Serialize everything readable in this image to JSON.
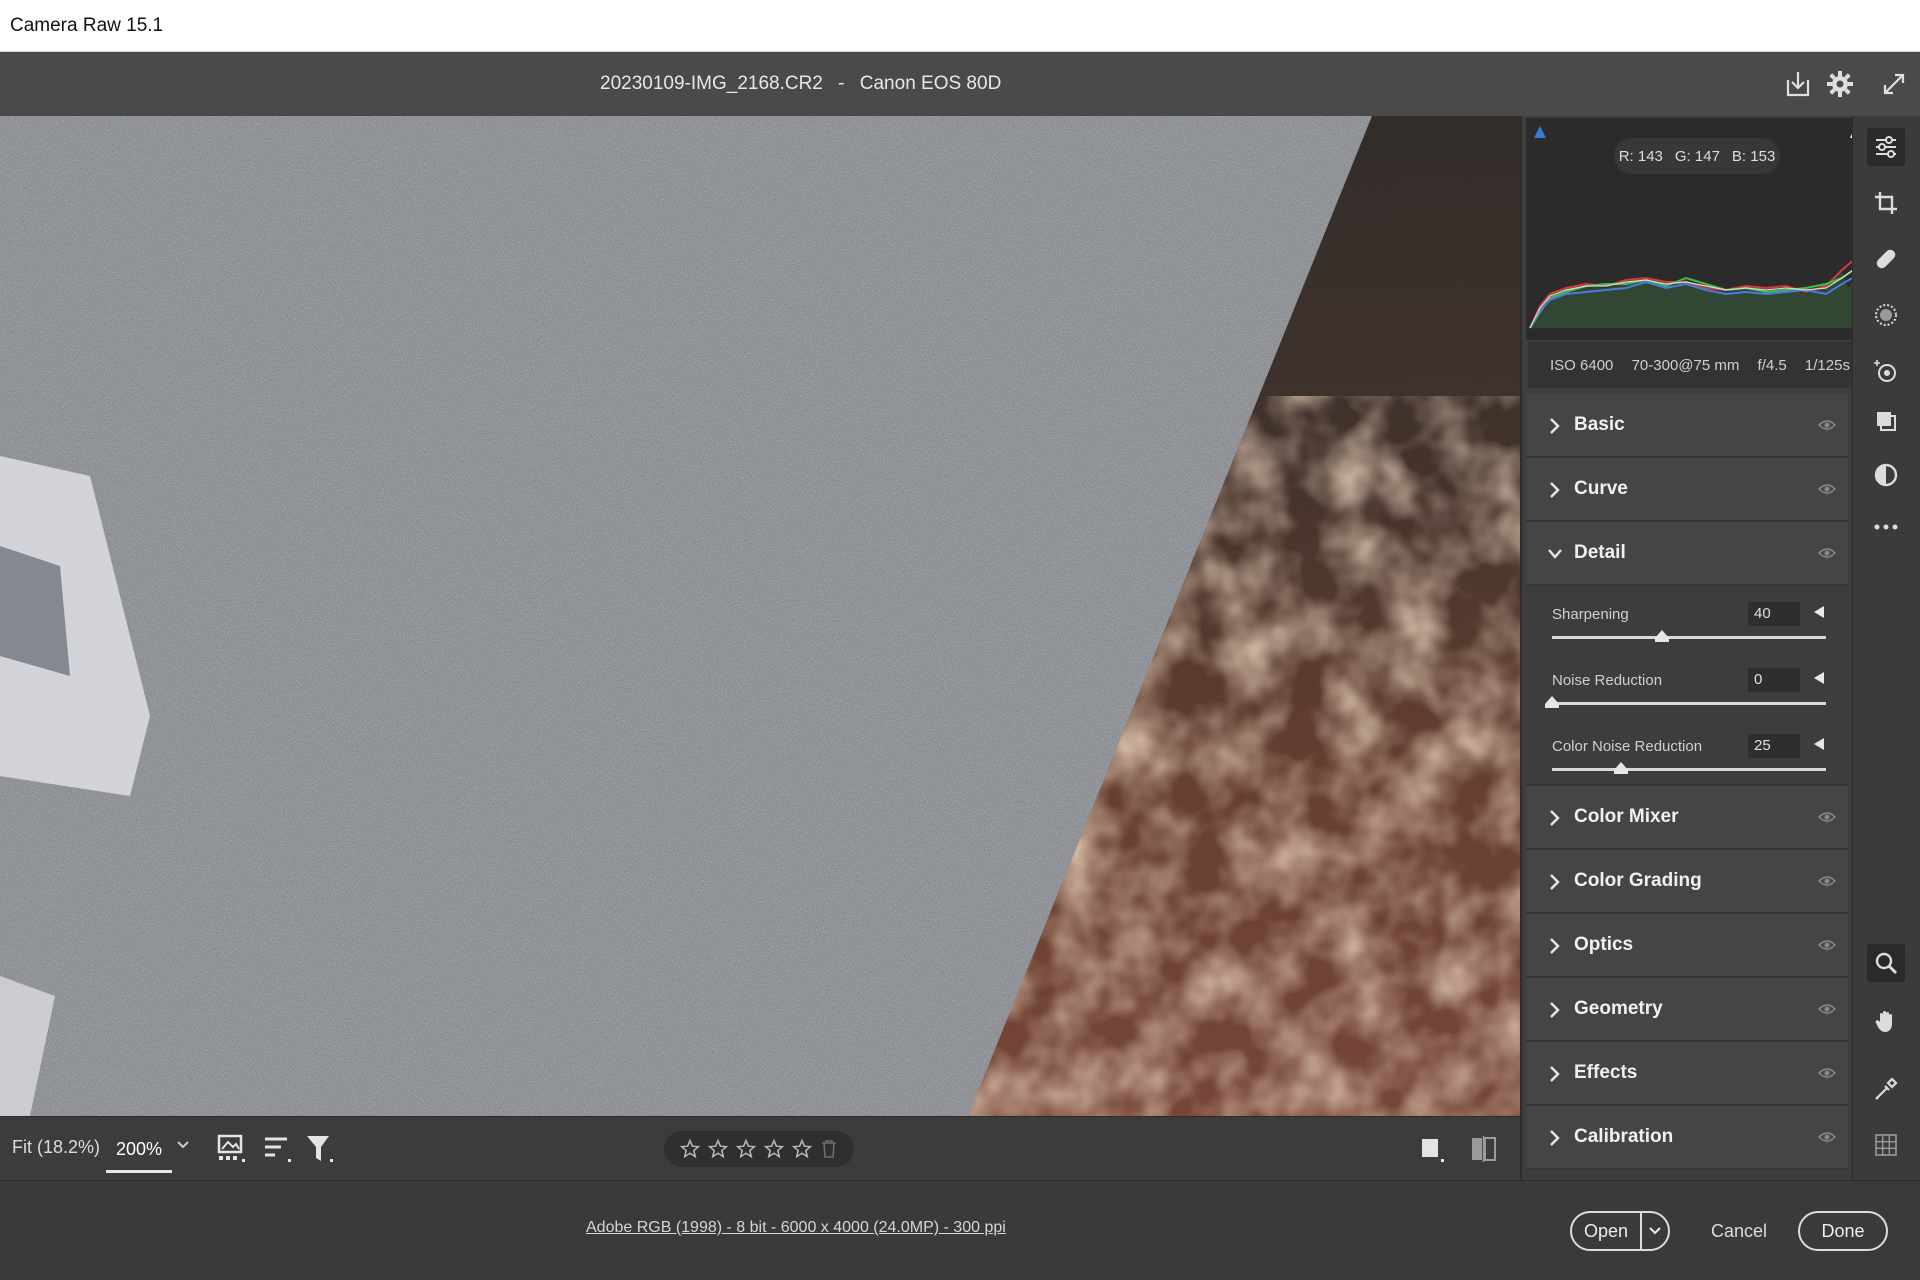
{
  "os_titlebar": {
    "title": "Camera Raw 15.1"
  },
  "header": {
    "filename": "20230109-IMG_2168.CR2",
    "separator": "-",
    "camera": "Canon EOS 80D",
    "icons": [
      "save-icon",
      "settings-gear-icon",
      "fullscreen-icon"
    ]
  },
  "histogram": {
    "readout": {
      "r": "R: 143",
      "g": "G: 147",
      "b": "B: 153"
    },
    "exif": {
      "iso": "ISO 6400",
      "lens": "70-300@75 mm",
      "aperture": "f/4.5",
      "shutter": "1/125s"
    }
  },
  "sections": {
    "basic": "Basic",
    "curve": "Curve",
    "detail": "Detail",
    "color_mixer": "Color Mixer",
    "color_grading": "Color Grading",
    "optics": "Optics",
    "geometry": "Geometry",
    "effects": "Effects",
    "calibration": "Calibration"
  },
  "detail": {
    "sharpening": {
      "label": "Sharpening",
      "value": "40",
      "level": 0.4
    },
    "noise_reduction": {
      "label": "Noise Reduction",
      "value": "0",
      "level": 0.0
    },
    "color_noise_reduction": {
      "label": "Color Noise Reduction",
      "value": "25",
      "level": 0.25
    }
  },
  "bottom_toolbar": {
    "fit_label": "Fit (18.2%)",
    "zoom_value": "200%",
    "rating_stars": 0
  },
  "footer": {
    "image_info": "Adobe RGB (1998) - 8 bit - 6000 x 4000 (24.0MP) - 300 ppi",
    "open_label": "Open",
    "cancel_label": "Cancel",
    "done_label": "Done"
  },
  "tools": [
    "edit-sliders-icon",
    "crop-icon",
    "healing-icon",
    "masking-icon",
    "red-eye-icon",
    "snapshots-icon",
    "presets-icon",
    "more-icon",
    "zoom-icon",
    "hand-icon",
    "color-sampler-icon",
    "grid-overlay-icon"
  ]
}
